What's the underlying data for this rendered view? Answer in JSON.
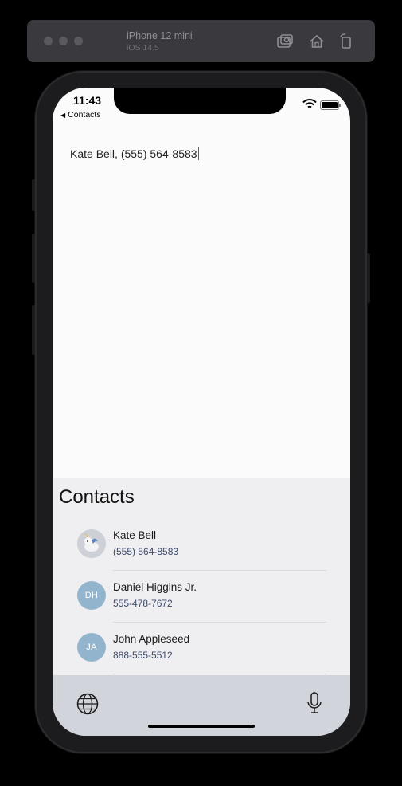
{
  "simulator": {
    "device_name": "iPhone 12 mini",
    "os_version": "iOS 14.5",
    "icons": [
      "screenshot-icon",
      "home-icon",
      "rotate-icon"
    ]
  },
  "status_bar": {
    "time": "11:43",
    "back_label": "Contacts",
    "icons": [
      "wifi-icon",
      "battery-icon"
    ]
  },
  "text_field": {
    "value": "Kate Bell, (555) 564-8583"
  },
  "contacts_panel": {
    "title": "Contacts",
    "contacts": [
      {
        "name": "Kate Bell",
        "phone": "(555) 564-8583",
        "initials": "",
        "avatar": "photo"
      },
      {
        "name": "Daniel Higgins Jr.",
        "phone": "555-478-7672",
        "initials": "DH",
        "avatar": "initials"
      },
      {
        "name": "John Appleseed",
        "phone": "888-555-5512",
        "initials": "JA",
        "avatar": "initials"
      }
    ],
    "avatar_color": "#93b4cd"
  },
  "keyboard": {
    "icons": [
      "globe-icon",
      "microphone-icon"
    ]
  }
}
